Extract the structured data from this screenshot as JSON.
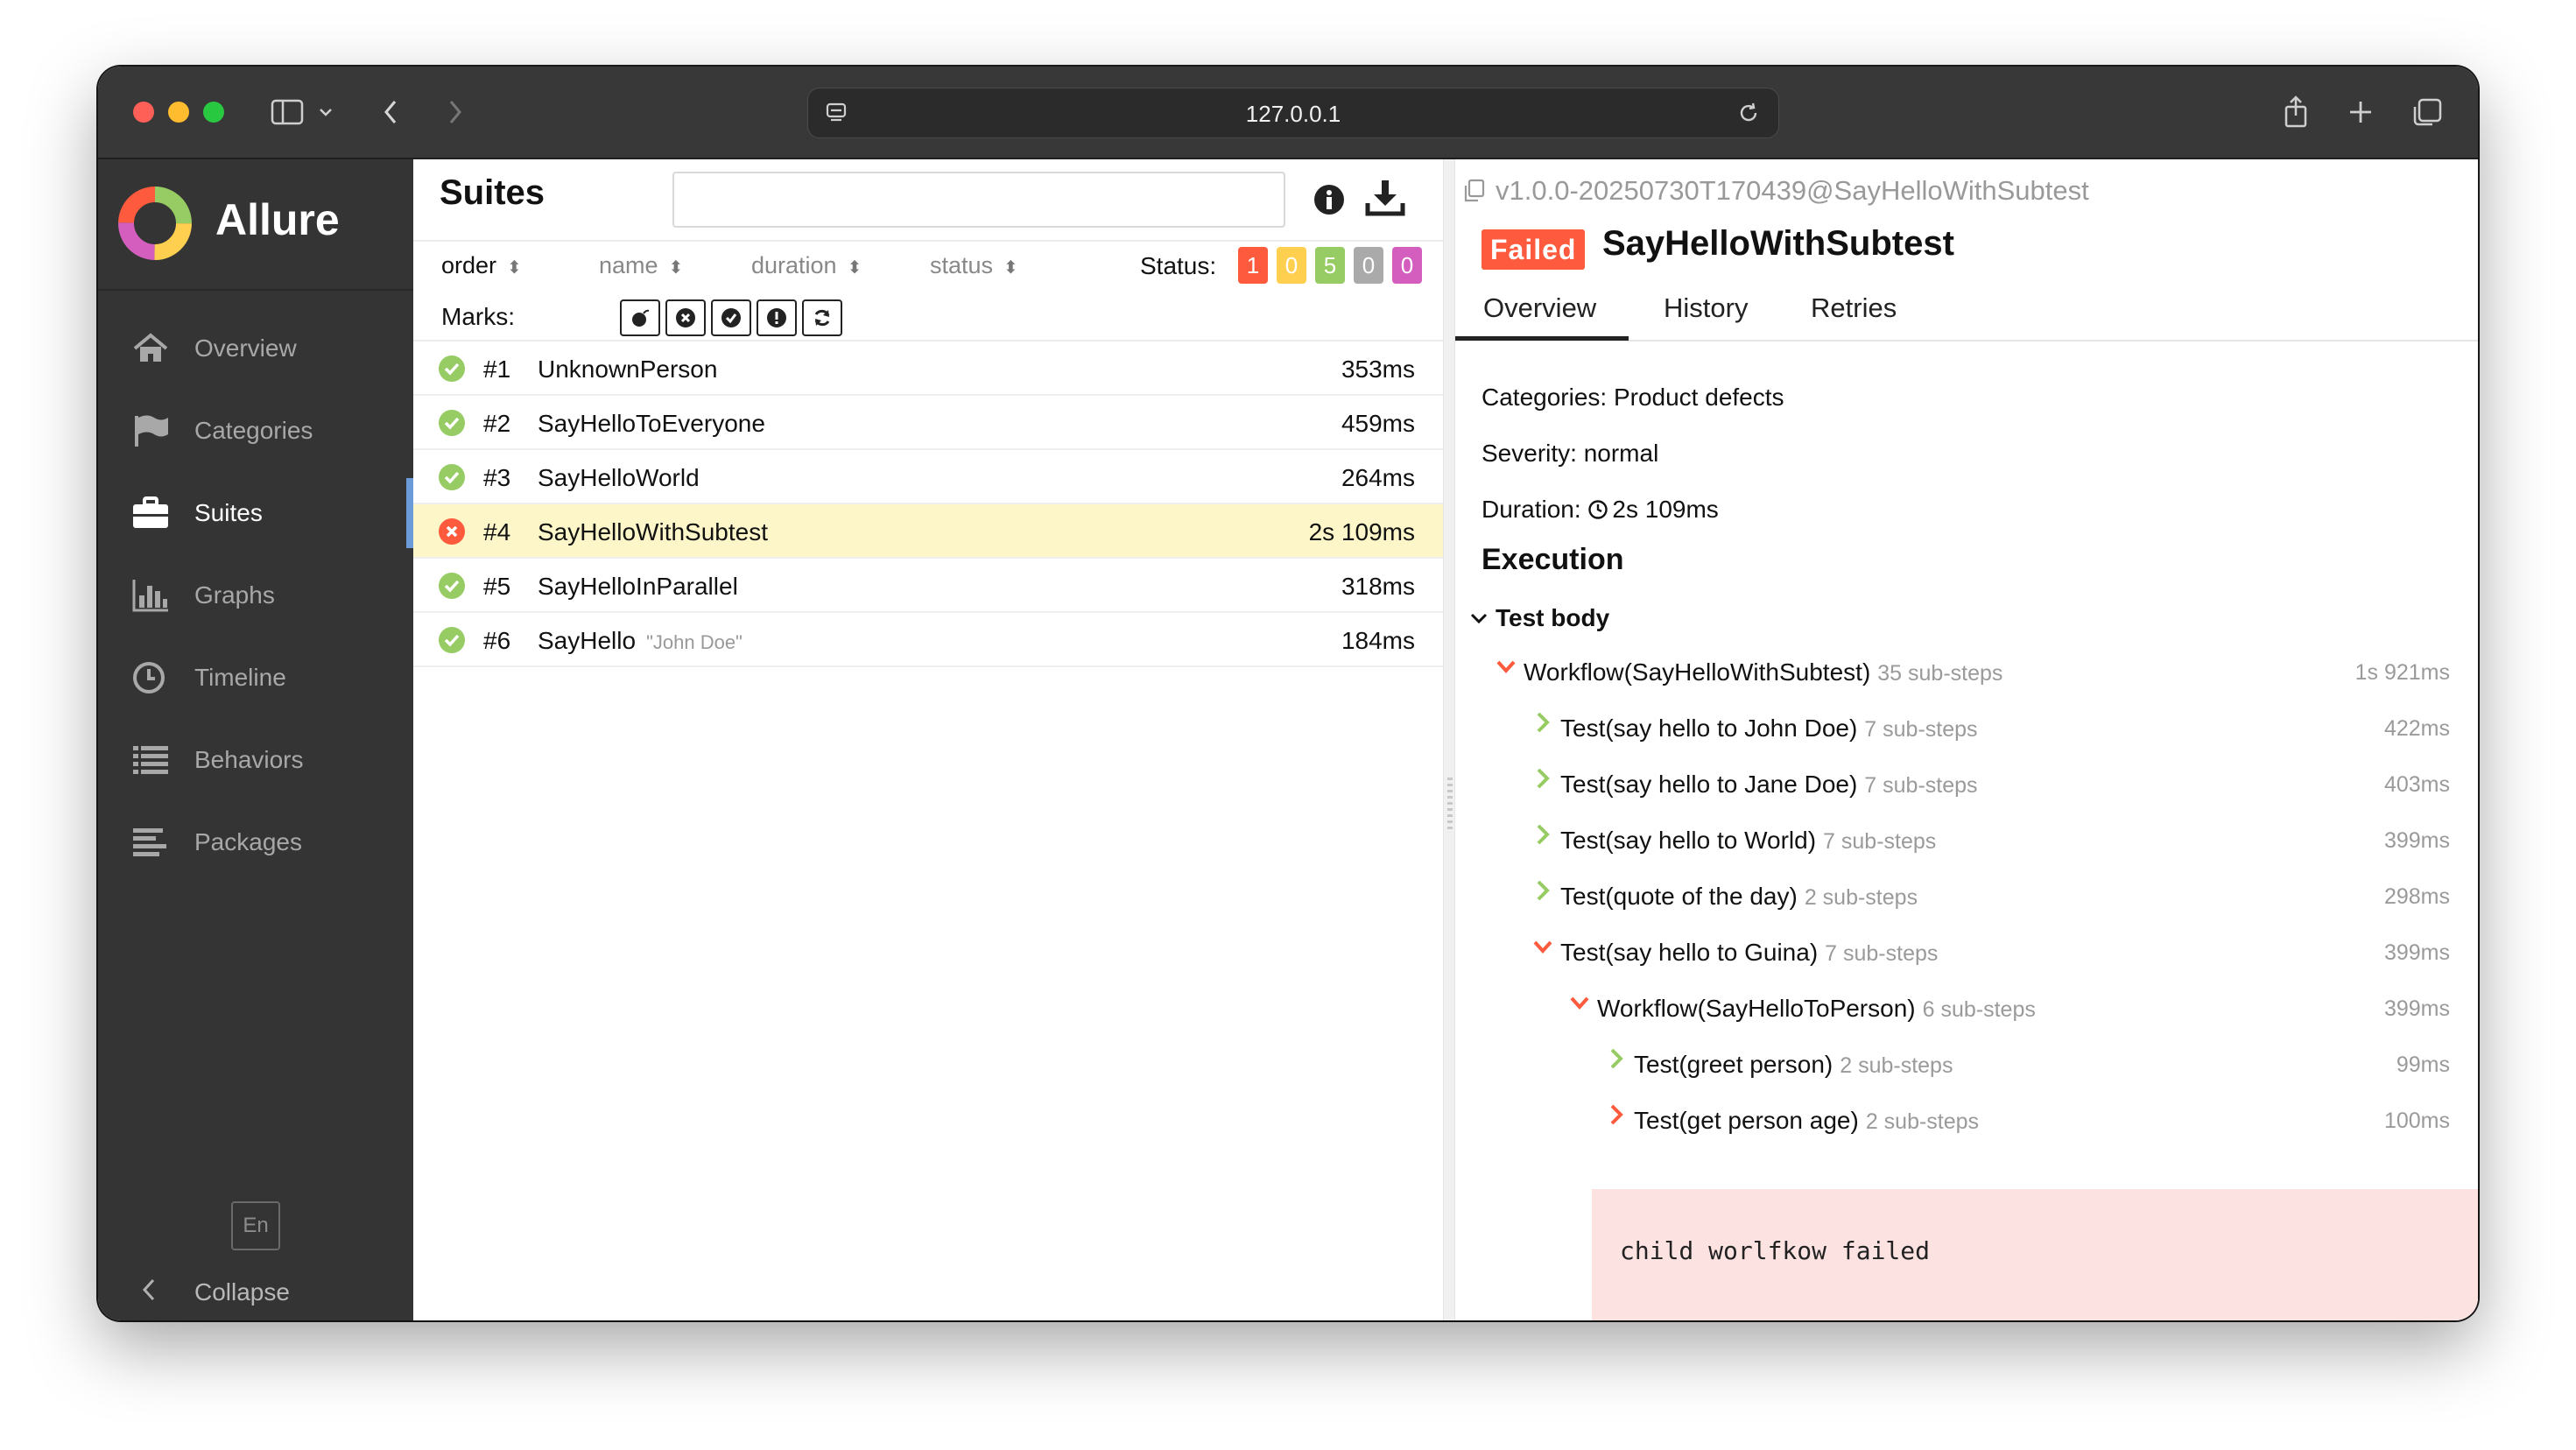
{
  "browser": {
    "url": "127.0.0.1"
  },
  "app": {
    "brand": "Allure",
    "nav": [
      {
        "label": "Overview",
        "icon": "home-icon"
      },
      {
        "label": "Categories",
        "icon": "flag-icon"
      },
      {
        "label": "Suites",
        "icon": "briefcase-icon"
      },
      {
        "label": "Graphs",
        "icon": "bar-chart-icon"
      },
      {
        "label": "Timeline",
        "icon": "clock-icon"
      },
      {
        "label": "Behaviors",
        "icon": "list-icon"
      },
      {
        "label": "Packages",
        "icon": "align-left-icon"
      }
    ],
    "active_nav": "Suites",
    "language": "En",
    "collapse_label": "Collapse"
  },
  "suites": {
    "title": "Suites",
    "search": {
      "value": "",
      "placeholder": ""
    },
    "sort": {
      "order": "order",
      "name": "name",
      "duration": "duration",
      "status": "status"
    },
    "status_label": "Status:",
    "status_counts": [
      {
        "value": "1",
        "color": "#fd5a3e"
      },
      {
        "value": "0",
        "color": "#ffd050"
      },
      {
        "value": "5",
        "color": "#97cc64"
      },
      {
        "value": "0",
        "color": "#aaaaaa"
      },
      {
        "value": "0",
        "color": "#d35ebe"
      }
    ],
    "marks_label": "Marks:",
    "marks": [
      "bomb-icon",
      "x-circle-icon",
      "check-circle-icon",
      "exclamation-icon",
      "refresh-icon"
    ],
    "tests": [
      {
        "num": "#1",
        "name": "UnknownPerson",
        "param": "",
        "duration": "353ms",
        "status": "passed"
      },
      {
        "num": "#2",
        "name": "SayHelloToEveryone",
        "param": "",
        "duration": "459ms",
        "status": "passed"
      },
      {
        "num": "#3",
        "name": "SayHelloWorld",
        "param": "",
        "duration": "264ms",
        "status": "passed"
      },
      {
        "num": "#4",
        "name": "SayHelloWithSubtest",
        "param": "",
        "duration": "2s 109ms",
        "status": "failed"
      },
      {
        "num": "#5",
        "name": "SayHelloInParallel",
        "param": "",
        "duration": "318ms",
        "status": "passed"
      },
      {
        "num": "#6",
        "name": "SayHello",
        "param": "\"John Doe\"",
        "duration": "184ms",
        "status": "passed"
      }
    ]
  },
  "detail": {
    "uid": "v1.0.0-20250730T170439@SayHelloWithSubtest",
    "status_badge": "Failed",
    "title": "SayHelloWithSubtest",
    "tabs": [
      "Overview",
      "History",
      "Retries"
    ],
    "active_tab": "Overview",
    "categories": "Categories: Product defects",
    "severity": "Severity: normal",
    "duration_label": "Duration:",
    "duration_value": "2s 109ms",
    "execution_title": "Execution",
    "test_body_label": "Test body",
    "steps": [
      {
        "name": "Workflow(SayHelloWithSubtest)",
        "sub": "35 sub-steps",
        "duration": "1s 921ms",
        "level": 0,
        "expanded": true,
        "status": "failed"
      },
      {
        "name": "Test(say hello to John Doe)",
        "sub": "7 sub-steps",
        "duration": "422ms",
        "level": 1,
        "expanded": false,
        "status": "passed"
      },
      {
        "name": "Test(say hello to Jane Doe)",
        "sub": "7 sub-steps",
        "duration": "403ms",
        "level": 1,
        "expanded": false,
        "status": "passed"
      },
      {
        "name": "Test(say hello to World)",
        "sub": "7 sub-steps",
        "duration": "399ms",
        "level": 1,
        "expanded": false,
        "status": "passed"
      },
      {
        "name": "Test(quote of the day)",
        "sub": "2 sub-steps",
        "duration": "298ms",
        "level": 1,
        "expanded": false,
        "status": "passed"
      },
      {
        "name": "Test(say hello to Guina)",
        "sub": "7 sub-steps",
        "duration": "399ms",
        "level": 1,
        "expanded": true,
        "status": "failed"
      },
      {
        "name": "Workflow(SayHelloToPerson)",
        "sub": "6 sub-steps",
        "duration": "399ms",
        "level": 2,
        "expanded": true,
        "status": "failed"
      },
      {
        "name": "Test(greet person)",
        "sub": "2 sub-steps",
        "duration": "99ms",
        "level": 3,
        "expanded": false,
        "status": "passed"
      },
      {
        "name": "Test(get person age)",
        "sub": "2 sub-steps",
        "duration": "100ms",
        "level": 3,
        "expanded": false,
        "status": "failed"
      }
    ],
    "error_message": "child worlfkow failed"
  }
}
